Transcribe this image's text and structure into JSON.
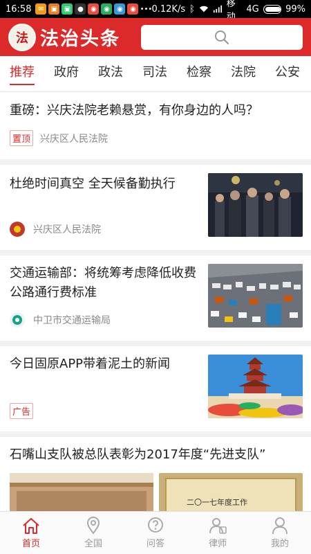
{
  "status_bar": {
    "time": "16:58",
    "speed": "0.12K/s",
    "carrier": "移动",
    "network": "4G",
    "battery": "99%"
  },
  "header": {
    "emblem_text": "法",
    "brand": "法治头条",
    "search_icon": "search-icon"
  },
  "tabs": [
    "推荐",
    "政府",
    "政法",
    "司法",
    "检察",
    "法院",
    "公安"
  ],
  "feed": [
    {
      "title": "重磅：兴庆法院老赖悬赏，有你身边的人吗？",
      "tag": "置顶",
      "source": "兴庆区人民法院"
    },
    {
      "title": "杜绝时间真空 全天候备勤执行",
      "source": "兴庆区人民法院"
    },
    {
      "title": "交通运输部：将统筹考虑降低收费公路通行费标准",
      "source": "中卫市交通运输局"
    },
    {
      "title": "今日固原APP带着泥土的新闻",
      "tag": "广告"
    },
    {
      "title": "石嘴山支队被总队表彰为2017年度“先进支队”",
      "image_caption": "二〇一七年度工作"
    }
  ],
  "bottom_nav": [
    {
      "label": "首页",
      "icon": "home-icon"
    },
    {
      "label": "全国",
      "icon": "location-pin-icon"
    },
    {
      "label": "问答",
      "icon": "question-bubble-icon"
    },
    {
      "label": "律师",
      "icon": "lawyer-icon"
    },
    {
      "label": "我的",
      "icon": "user-icon"
    }
  ],
  "colors": {
    "brand_red": "#dc2929",
    "gray_text": "#888888"
  }
}
